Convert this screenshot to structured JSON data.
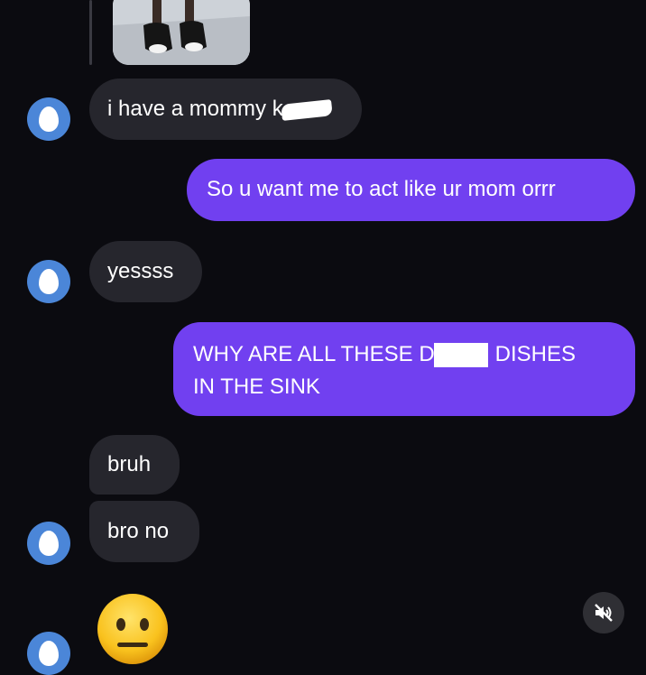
{
  "messages": [
    {
      "id": "m1",
      "direction": "received",
      "text": "i have a mommy k",
      "censored": true
    },
    {
      "id": "m2",
      "direction": "sent",
      "text": "So u want me to act like ur mom orrr"
    },
    {
      "id": "m3",
      "direction": "received",
      "text": "yessss"
    },
    {
      "id": "m4",
      "direction": "sent",
      "line1_part1": "WHY ARE ALL THESE D",
      "line1_part2": "DISHES",
      "line2": "IN THE SINK",
      "censored": true
    },
    {
      "id": "m5",
      "direction": "received",
      "text": "bruh"
    },
    {
      "id": "m6",
      "direction": "received",
      "text": "bro no"
    },
    {
      "id": "m7",
      "direction": "received",
      "emoji": "😐"
    }
  ],
  "colors": {
    "background": "#0b0b10",
    "received_bubble": "#26262d",
    "sent_bubble": "#7140f0",
    "avatar": "#4b86d8"
  },
  "icons": {
    "avatar": "egg-avatar-icon",
    "sound": "speaker-muted-icon"
  }
}
